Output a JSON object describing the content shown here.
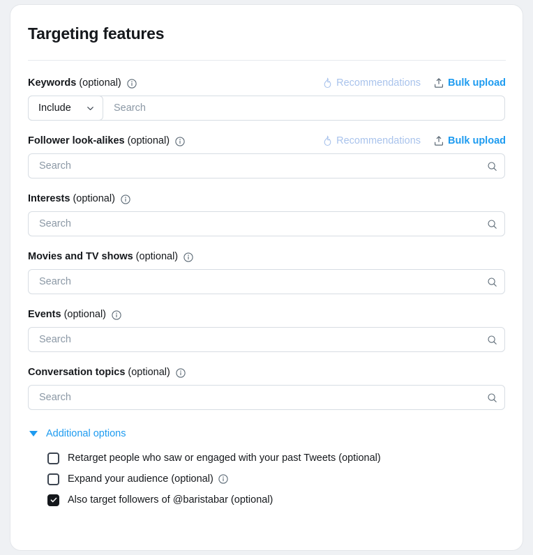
{
  "card": {
    "title": "Targeting features"
  },
  "actions": {
    "recommendations_label": "Recommendations",
    "recommendations_icon": "flame-icon",
    "bulk_upload_label": "Bulk upload",
    "bulk_upload_icon": "upload-icon"
  },
  "common": {
    "optional_suffix": "(optional)",
    "search_placeholder": "Search",
    "info_icon": "info-circle-icon",
    "search_icon": "search-icon",
    "chevron_icon": "chevron-down-icon"
  },
  "fields": [
    {
      "id": "keywords",
      "label": "Keywords",
      "optional": "(optional)",
      "has_info": true,
      "has_actions": true,
      "has_select": true,
      "select_value": "Include",
      "has_search_icon": false,
      "placeholder": "Search"
    },
    {
      "id": "follower-look-alikes",
      "label": "Follower look-alikes",
      "optional": "(optional)",
      "has_info": true,
      "has_actions": true,
      "has_select": false,
      "has_search_icon": true,
      "placeholder": "Search"
    },
    {
      "id": "interests",
      "label": "Interests",
      "optional": "(optional)",
      "has_info": true,
      "has_actions": false,
      "has_select": false,
      "has_search_icon": true,
      "placeholder": "Search"
    },
    {
      "id": "movies-and-tv-shows",
      "label": "Movies and TV shows",
      "optional": "(optional)",
      "has_info": true,
      "has_actions": false,
      "has_select": false,
      "has_search_icon": true,
      "placeholder": "Search"
    },
    {
      "id": "events",
      "label": "Events",
      "optional": "(optional)",
      "has_info": true,
      "has_actions": false,
      "has_select": false,
      "has_search_icon": true,
      "placeholder": "Search"
    },
    {
      "id": "conversation-topics",
      "label": "Conversation topics",
      "optional": "(optional)",
      "has_info": true,
      "has_actions": false,
      "has_select": false,
      "has_search_icon": true,
      "placeholder": "Search"
    }
  ],
  "additional_options": {
    "label": "Additional options",
    "expanded": true,
    "disclosure_icon": "triangle-down-icon",
    "checkboxes": [
      {
        "id": "retarget-past-tweets",
        "label": "Retarget people who saw or engaged with your past Tweets (optional)",
        "checked": false,
        "has_info": false
      },
      {
        "id": "expand-audience",
        "label": "Expand your audience (optional)",
        "checked": false,
        "has_info": true
      },
      {
        "id": "also-target-followers",
        "label": "Also target followers of @baristabar (optional)",
        "checked": true,
        "has_info": false
      }
    ]
  },
  "colors": {
    "accent_blue": "#1d9bf0",
    "muted_blue": "#a9c3ec",
    "text": "#15181c",
    "placeholder": "#8b98a5",
    "border": "#d7dde3",
    "page_bg": "#eff1f4"
  }
}
